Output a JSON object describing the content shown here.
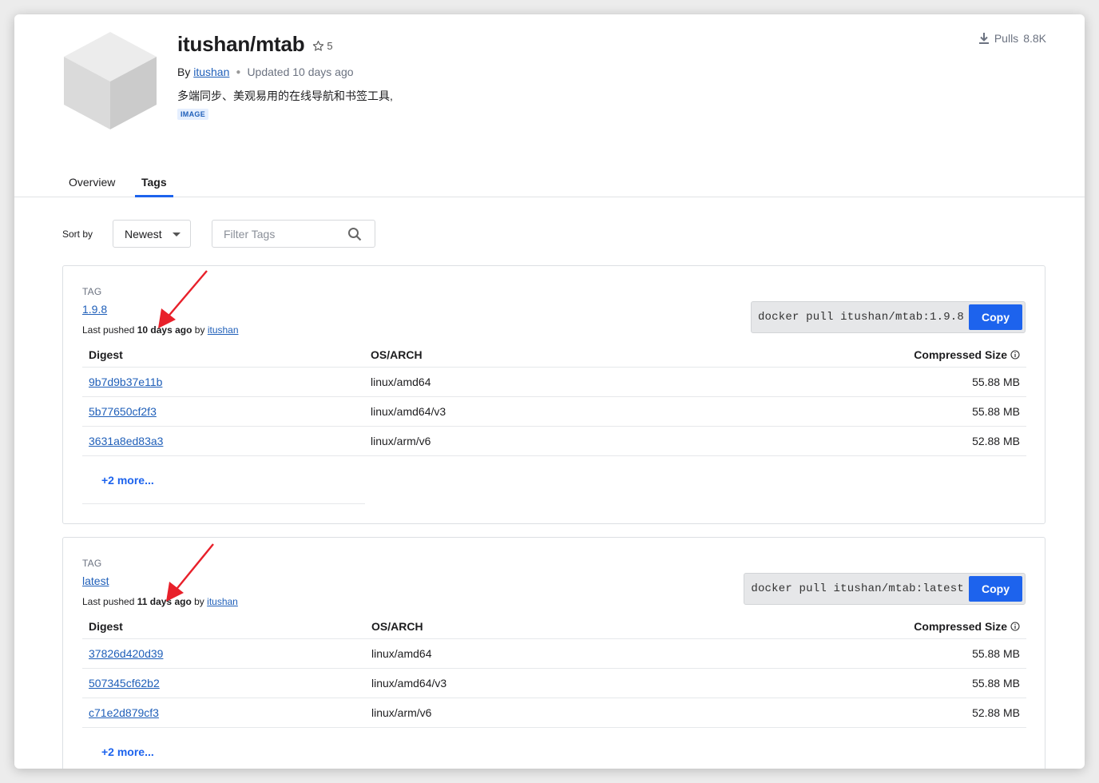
{
  "header": {
    "repo_name": "itushan/mtab",
    "star_count": "5",
    "by_label": "By",
    "author": "itushan",
    "updated": "Updated 10 days ago",
    "description": "多端同步、美观易用的在线导航和书签工具,",
    "badge": "IMAGE",
    "pulls_label": "Pulls",
    "pulls_count": "8.8K"
  },
  "tabs": [
    {
      "label": "Overview",
      "active": false
    },
    {
      "label": "Tags",
      "active": true
    }
  ],
  "controls": {
    "sort_label": "Sort by",
    "sort_value": "Newest",
    "filter_placeholder": "Filter Tags"
  },
  "columns": {
    "digest": "Digest",
    "arch": "OS/ARCH",
    "size": "Compressed Size"
  },
  "tags": [
    {
      "label": "TAG",
      "name": "1.9.8",
      "pushed_prefix": "Last pushed",
      "pushed_time": "10 days ago",
      "pushed_by": "by",
      "pusher": "itushan",
      "pull_command": "docker pull itushan/mtab:1.9.8",
      "copy_label": "Copy",
      "rows": [
        {
          "digest": "9b7d9b37e11b",
          "arch": "linux/amd64",
          "size": "55.88 MB"
        },
        {
          "digest": "5b77650cf2f3",
          "arch": "linux/amd64/v3",
          "size": "55.88 MB"
        },
        {
          "digest": "3631a8ed83a3",
          "arch": "linux/arm/v6",
          "size": "52.88 MB"
        }
      ],
      "more": "+2 more..."
    },
    {
      "label": "TAG",
      "name": "latest",
      "pushed_prefix": "Last pushed",
      "pushed_time": "11 days ago",
      "pushed_by": "by",
      "pusher": "itushan",
      "pull_command": "docker pull itushan/mtab:latest",
      "copy_label": "Copy",
      "rows": [
        {
          "digest": "37826d420d39",
          "arch": "linux/amd64",
          "size": "55.88 MB"
        },
        {
          "digest": "507345cf62b2",
          "arch": "linux/amd64/v3",
          "size": "55.88 MB"
        },
        {
          "digest": "c71e2d879cf3",
          "arch": "linux/arm/v6",
          "size": "52.88 MB"
        }
      ],
      "more": "+2 more..."
    }
  ],
  "colors": {
    "accent": "#1d63ed",
    "link": "#1f5fb9",
    "annotation_arrow": "#e8202a"
  }
}
